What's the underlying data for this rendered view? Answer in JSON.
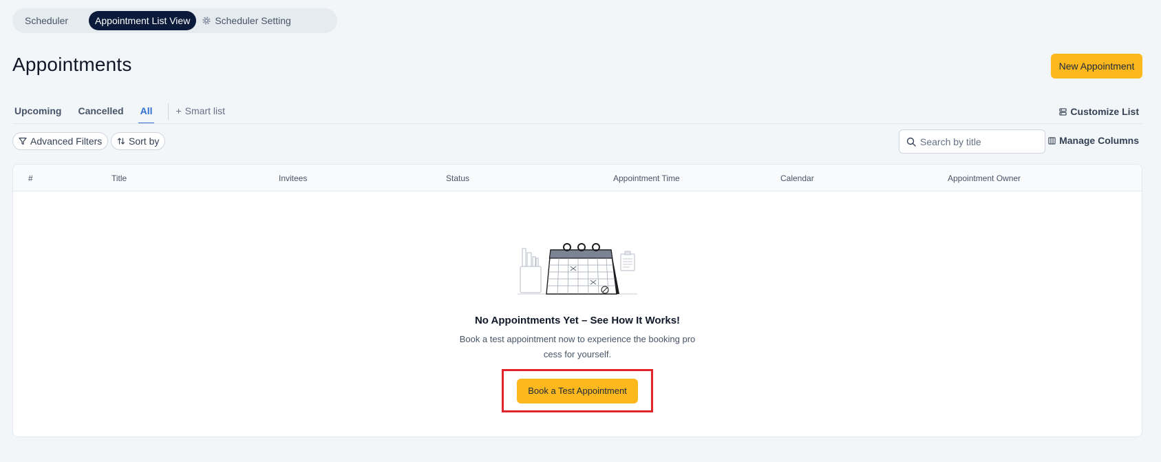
{
  "topnav": {
    "tabs": [
      {
        "label": "Scheduler"
      },
      {
        "label": "Appointment List View"
      },
      {
        "label": "Scheduler Setting"
      }
    ]
  },
  "header": {
    "title": "Appointments",
    "new_button": "New Appointment"
  },
  "filter_tabs": {
    "items": [
      {
        "label": "Upcoming"
      },
      {
        "label": "Cancelled"
      },
      {
        "label": "All"
      }
    ],
    "smart_list": "Smart list",
    "customize": "Customize List"
  },
  "toolbar": {
    "advanced_filters": "Advanced Filters",
    "sort_by": "Sort by",
    "search_placeholder": "Search by title",
    "manage_columns": "Manage Columns"
  },
  "table": {
    "columns": [
      "#",
      "Title",
      "Invitees",
      "Status",
      "Appointment Time",
      "Calendar",
      "Appointment Owner"
    ]
  },
  "empty_state": {
    "title": "No Appointments Yet – See How It Works!",
    "line1": "Book a test appointment now to experience the booking pro",
    "line2": "cess for yourself.",
    "button": "Book a Test Appointment"
  },
  "colors": {
    "accent": "#fdb81e",
    "active_tab": "#2e6fcf",
    "nav_active": "#0b1a3a",
    "highlight": "#e3242b"
  }
}
